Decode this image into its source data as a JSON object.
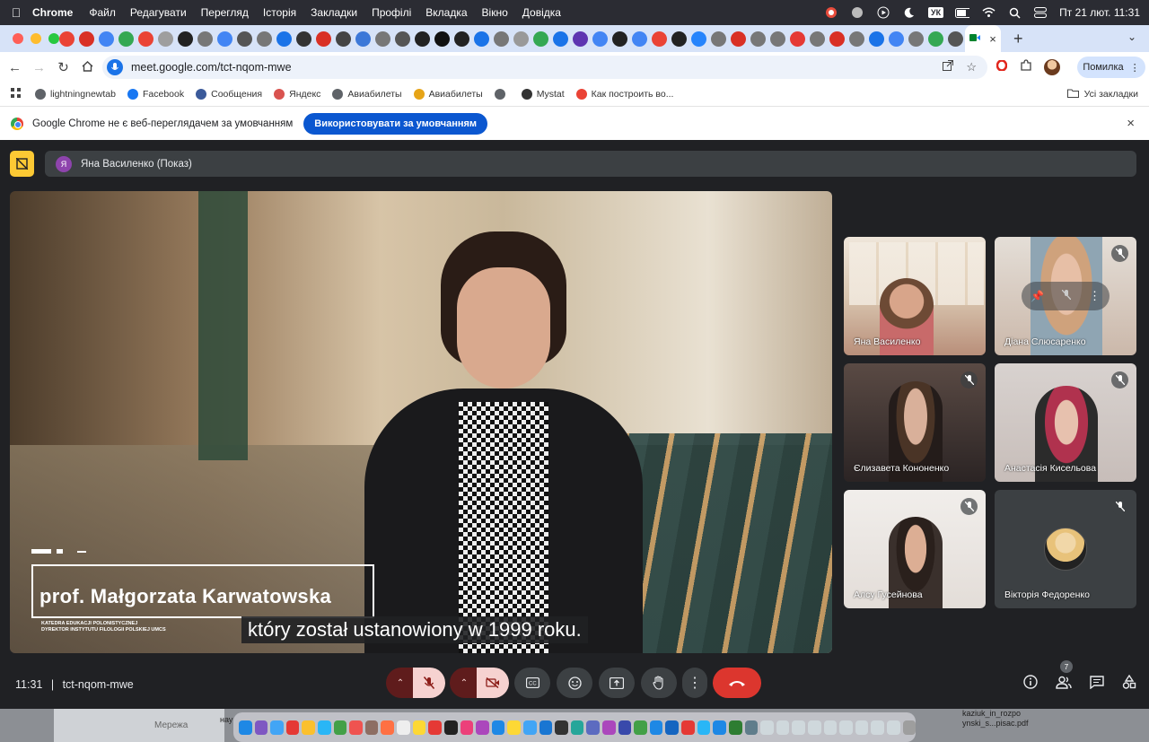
{
  "menubar": {
    "app": "Chrome",
    "items": [
      "Файл",
      "Редагувати",
      "Перегляд",
      "Історія",
      "Закладки",
      "Профілі",
      "Вкладка",
      "Вікно",
      "Довідка"
    ],
    "keyboard": "УК",
    "datetime": "Пт 21 лют.  11:31"
  },
  "browser": {
    "url": "meet.google.com/tct-nqom-mwe",
    "profile_button": "Помилка"
  },
  "bookmarks": {
    "items": [
      {
        "label": "lightningnewtab",
        "icon": "globe-icon",
        "color": "#5f6368"
      },
      {
        "label": "Facebook",
        "icon": "facebook-icon",
        "color": "#1877f2"
      },
      {
        "label": "Сообщения",
        "icon": "messages-icon",
        "color": "#3b5a9a"
      },
      {
        "label": "Яндекс",
        "icon": "yandex-icon",
        "color": "#d9534f"
      },
      {
        "label": "Авиабилеты",
        "icon": "globe-icon",
        "color": "#5f6368"
      },
      {
        "label": "Авиабилеты",
        "icon": "plane-icon",
        "color": "#e6a417"
      },
      {
        "label": "",
        "icon": "globe-icon",
        "color": "#5f6368"
      },
      {
        "label": "Mystat",
        "icon": "graduation-icon",
        "color": "#333333"
      },
      {
        "label": "Как построить во...",
        "icon": "google-icon",
        "color": "#ea4335"
      }
    ],
    "all_bookmarks": "Усі закладки"
  },
  "infobar": {
    "message": "Google Chrome не є веб-переглядачем за умовчанням",
    "button": "Використовувати за умовчанням"
  },
  "meet": {
    "presenter_initial": "Я",
    "presenter_label": "Яна Василенко (Показ)",
    "video": {
      "lower_third_name": "prof. Małgorzata Karwatowska",
      "lower_third_line1": "KATEDRA EDUKACJI POLONISTYCZNEJ",
      "lower_third_line2": "DYREKTOR INSTYTUTU FILOLOGII POLSKIEJ UMCS",
      "caption": "który został ustanowiony w 1999 roku."
    },
    "participants": [
      {
        "name": "Яна Василенко",
        "muted": false
      },
      {
        "name": "Діана Слюсаренко",
        "muted": true
      },
      {
        "name": "Єлизавета Кононенко",
        "muted": true
      },
      {
        "name": "Анастасія Кисельова",
        "muted": true
      },
      {
        "name": "Алсу Гусейнова",
        "muted": true
      },
      {
        "name": "Вікторія Федоренко",
        "muted": true
      }
    ],
    "time": "11:31",
    "separator": "|",
    "meeting_code": "tct-nqom-mwe",
    "participant_count": "7"
  },
  "desktop": {
    "sidebar_label": "Мережа",
    "file_label_line1": "kaziuk_in_rozpo",
    "file_label_line2": "ynski_s...pisac.pdf",
    "desk_text": "нау"
  },
  "colors": {
    "meet_bg": "#202124",
    "hangup": "#dc362e",
    "mic_off": "#f6d2d0",
    "chrome_blue": "#0b57d0"
  }
}
